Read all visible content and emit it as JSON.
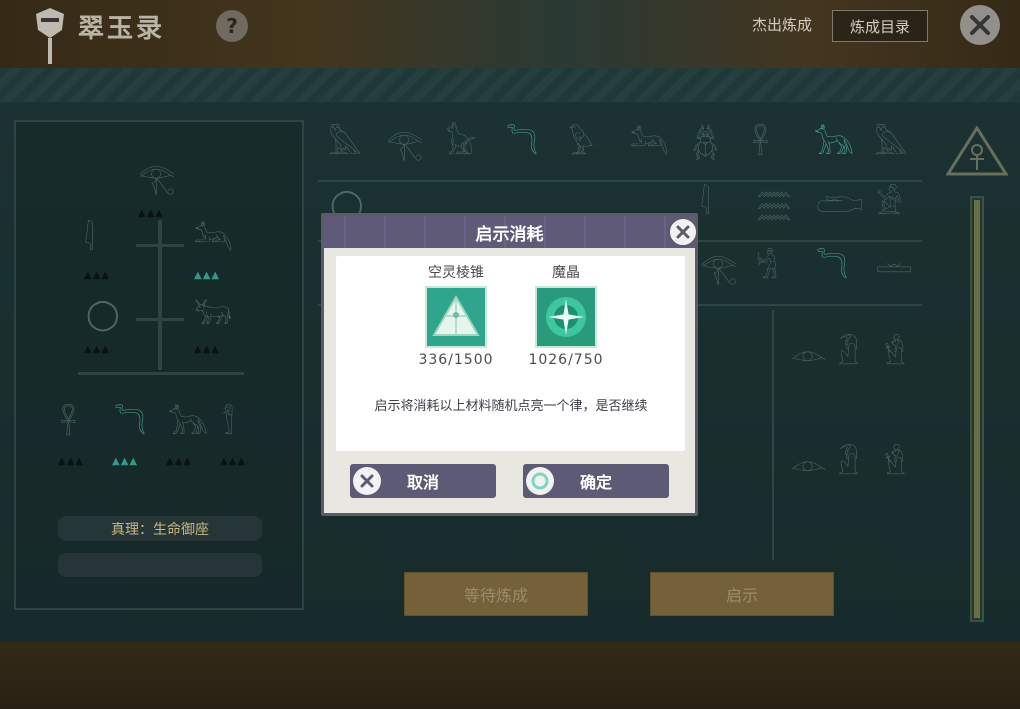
{
  "header": {
    "title": "翠玉录",
    "help_icon": "?",
    "link_label": "杰出炼成",
    "catalog_button": "炼成目录"
  },
  "left_panel": {
    "truth_label": "真理：生命御座"
  },
  "bottom_buttons": {
    "wait_label": "等待炼成",
    "reveal_label": "启示"
  },
  "dialog": {
    "title": "启示消耗",
    "items": [
      {
        "name": "空灵棱锥",
        "count": "336/1500",
        "icon": "pyramid-icon"
      },
      {
        "name": "魔晶",
        "count": "1026/750",
        "icon": "crystal-icon"
      }
    ],
    "description": "启示将消耗以上材料随机点亮一个律，是否继续",
    "cancel_label": "取消",
    "confirm_label": "确定"
  },
  "colors": {
    "accent": "#5d5a75",
    "panel": "#1f3737",
    "gold_button": "#7f6a3e",
    "teal_glyph": "#4fb3a8"
  }
}
